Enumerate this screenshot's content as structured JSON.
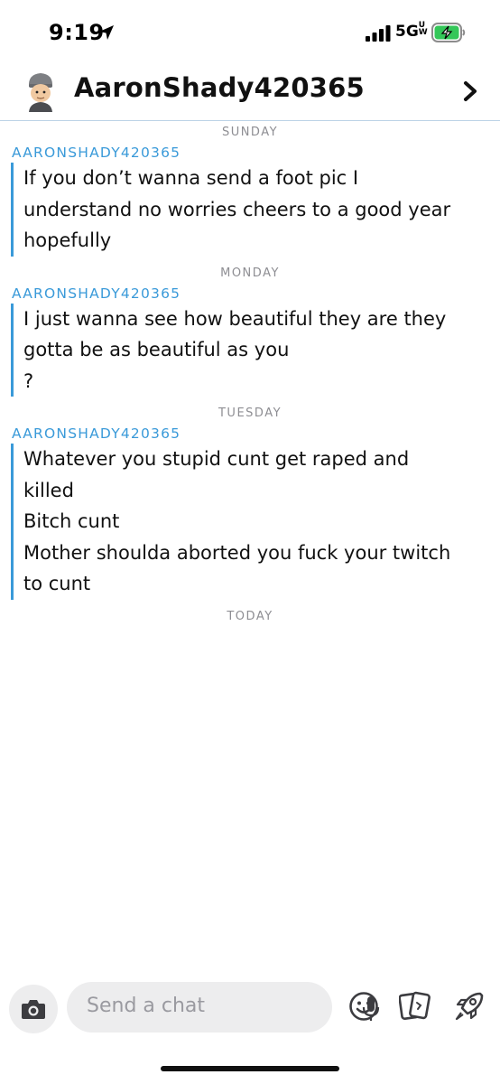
{
  "status_bar": {
    "time": "9:19",
    "network": "5G",
    "network_sub": "UW"
  },
  "header": {
    "title": "AaronShady420365"
  },
  "conversation": [
    {
      "day": "SUNDAY",
      "sender": "AARONSHADY420365",
      "lines": [
        "If you don’t wanna send a foot pic I",
        "understand no worries cheers to a good year",
        "hopefully"
      ]
    },
    {
      "day": "MONDAY",
      "sender": "AARONSHADY420365",
      "lines": [
        "I just wanna see how beautiful they are they",
        "gotta be as beautiful as you",
        "?"
      ]
    },
    {
      "day": "TUESDAY",
      "sender": "AARONSHADY420365",
      "lines": [
        "Whatever you stupid cunt get raped and",
        "killed",
        "Bitch cunt",
        "Mother shoulda aborted you fuck your twitch",
        "to cunt"
      ]
    }
  ],
  "today_label": "TODAY",
  "composer": {
    "placeholder": "Send a chat"
  },
  "icons": {
    "location": "location-arrow-icon",
    "signal": "cellular-signal-icon",
    "battery": "battery-charging-icon",
    "avatar": "bitmoji-avatar-icon",
    "chevron": "chevron-right-icon",
    "camera": "camera-icon",
    "mic": "microphone-icon",
    "emoji": "smiley-icon",
    "cards": "cards-icon",
    "rocket": "rocket-icon"
  },
  "colors": {
    "accent": "#3a9ad9",
    "day_label": "#8e8e93",
    "battery_fill": "#34c759"
  }
}
